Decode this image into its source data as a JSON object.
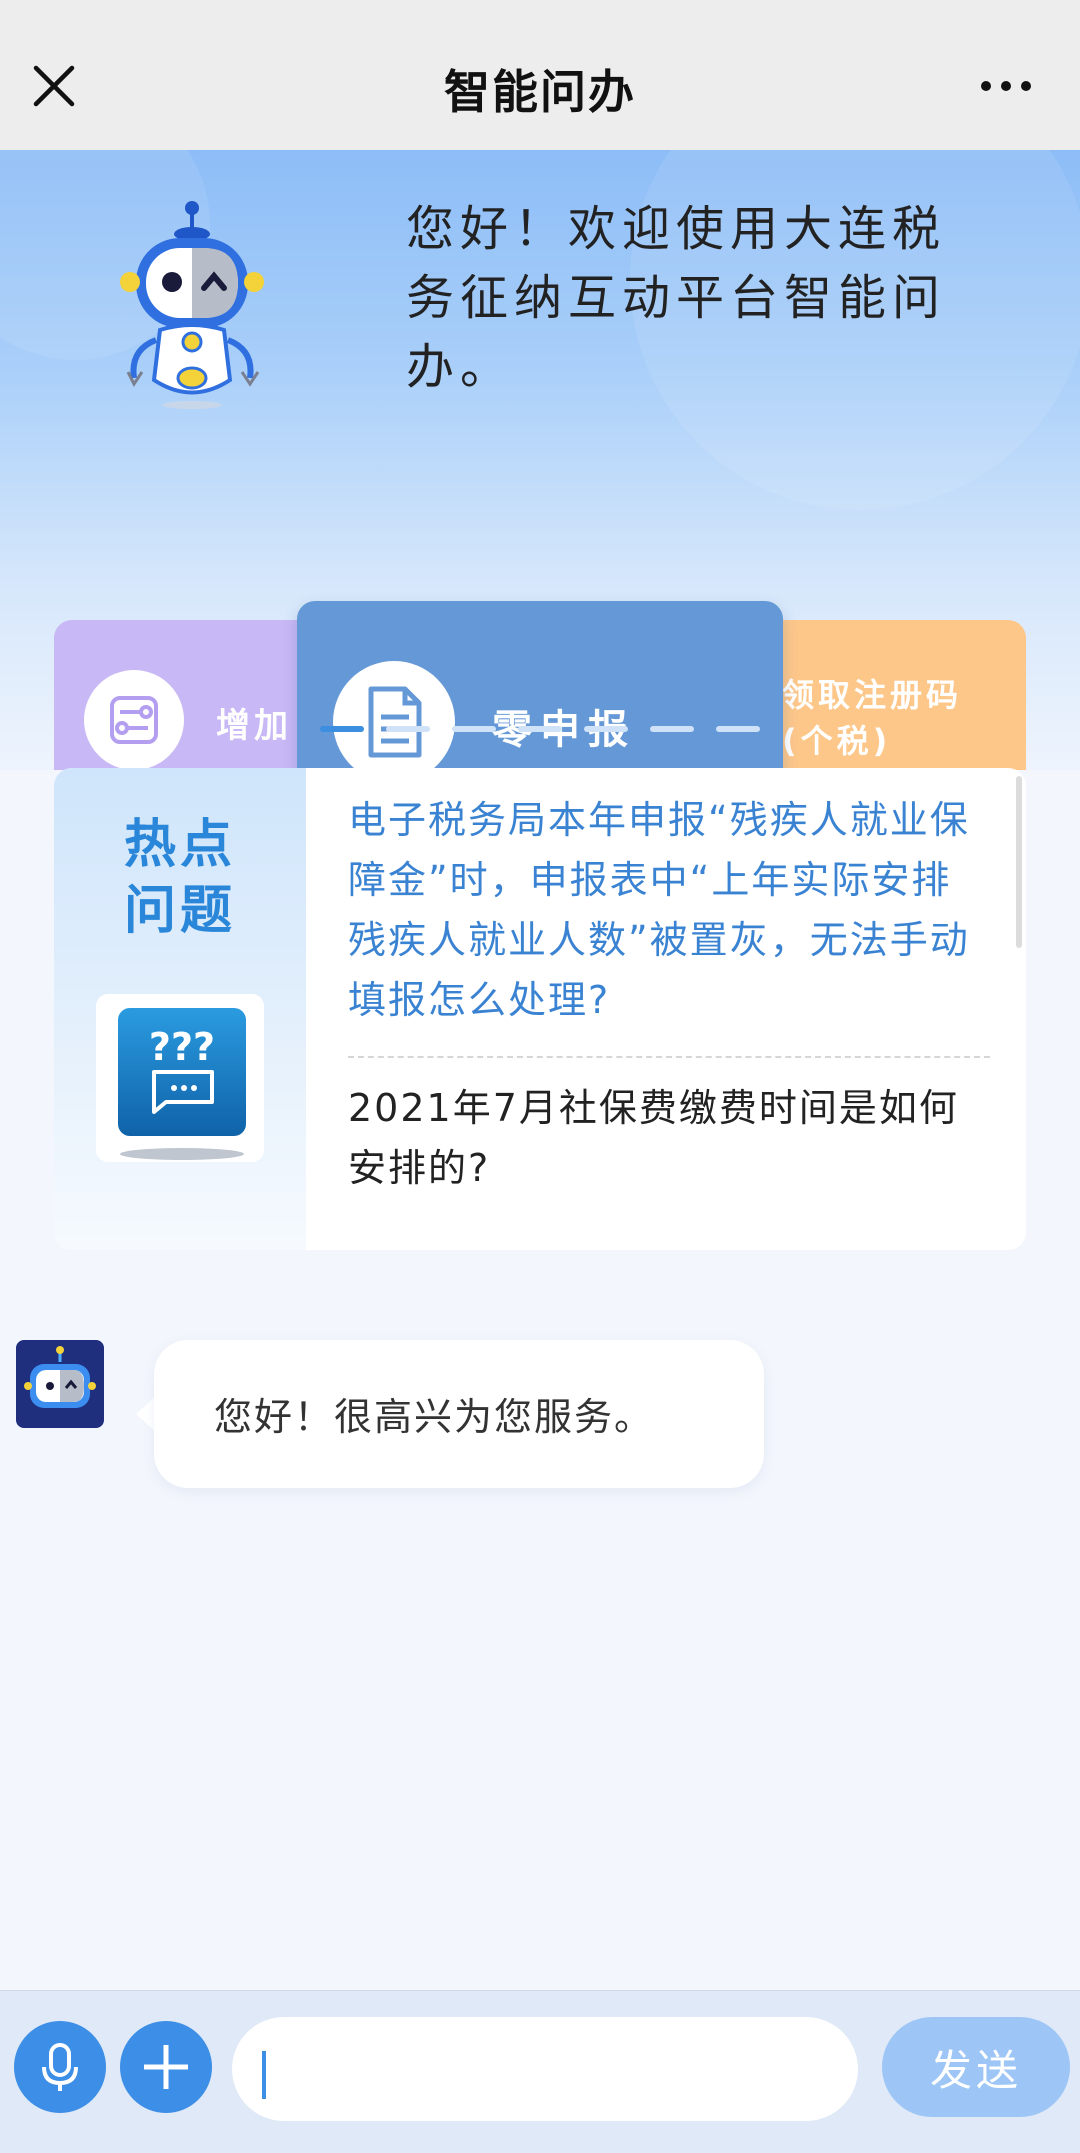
{
  "nav": {
    "title": "智能问办",
    "close_icon": "close-icon",
    "more_icon": "more-icon"
  },
  "hero": {
    "welcome": "您好！欢迎使用大连税务征纳互动平台智能问办。",
    "mascot": "robot-mascot"
  },
  "carousel": {
    "items": [
      {
        "label": "增加",
        "icon": "settings-card-icon",
        "color": "#c8b8f5"
      },
      {
        "label": "零申报",
        "icon": "document-icon",
        "color": "#6598d6"
      },
      {
        "label": "领取注册码\n(个税)",
        "color": "#fdc78a"
      }
    ],
    "active_index": 1,
    "page_count": 7,
    "accent": "#3c8ee0"
  },
  "hot": {
    "title": "热点\n问题",
    "questions": [
      "电子税务局本年申报“残疾人就业保障金”时，申报表中“上年实际安排残疾人就业人数”被置灰，无法手动填报怎么处理?",
      "2021年7月社保费缴费时间是如何安排的?"
    ],
    "title_color": "#2a86d8",
    "link_color": "#3a83d2"
  },
  "chat": {
    "messages": [
      {
        "from": "bot",
        "text": "您好！很高兴为您服务。"
      }
    ]
  },
  "input": {
    "value": "",
    "placeholder": "",
    "send_label": "发送",
    "mic_icon": "microphone-icon",
    "plus_icon": "plus-icon"
  }
}
